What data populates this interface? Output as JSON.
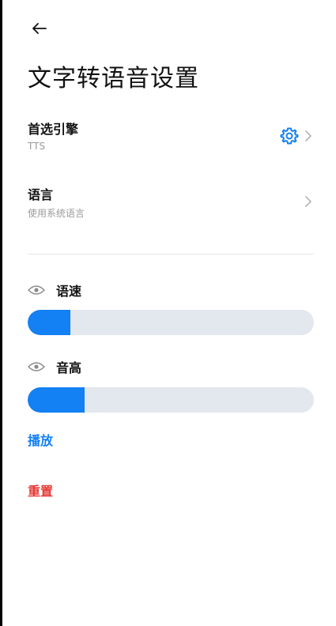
{
  "header": {
    "title": "文字转语音设置"
  },
  "settings": {
    "engine": {
      "label": "首选引擎",
      "value": "TTS"
    },
    "language": {
      "label": "语言",
      "value": "使用系统语言"
    }
  },
  "sliders": [
    {
      "label": "语速",
      "level_percent": 15
    },
    {
      "label": "音高",
      "level_percent": 20
    }
  ],
  "actions": {
    "play": "播放",
    "reset": "重置"
  },
  "colors": {
    "accent": "#1380f3",
    "danger": "#e53935",
    "track": "#e3e7ee"
  },
  "icons": {
    "back": "arrow-left-icon",
    "engine_settings": "gear-icon",
    "chevron": "chevron-right-icon",
    "preview": "eye-icon"
  }
}
